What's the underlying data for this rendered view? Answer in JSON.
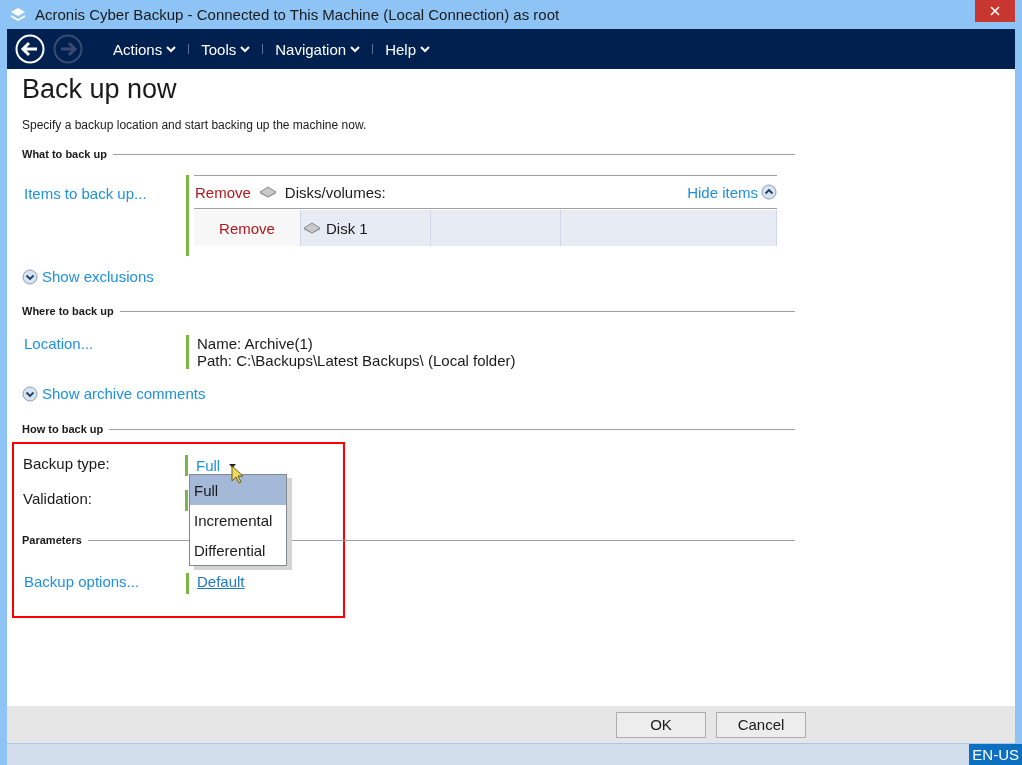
{
  "window": {
    "title": "Acronis Cyber Backup - Connected to This Machine (Local Connection) as root"
  },
  "nav": {
    "back_disabled": false,
    "forward_disabled": true
  },
  "menu": [
    {
      "label": "Actions"
    },
    {
      "label": "Tools"
    },
    {
      "label": "Navigation"
    },
    {
      "label": "Help"
    }
  ],
  "page": {
    "title": "Back up now",
    "description": "Specify a backup location and start backing up the machine now."
  },
  "what": {
    "heading": "What to back up",
    "link": "Items to back up...",
    "group": {
      "remove": "Remove",
      "label": "Disks/volumes:",
      "hide": "Hide items",
      "items": [
        {
          "remove": "Remove",
          "name": "Disk 1"
        }
      ]
    },
    "toggle": "Show exclusions"
  },
  "where": {
    "heading": "Where to back up",
    "link": "Location...",
    "lines": [
      "Name: Archive(1)",
      "Path: C:\\Backups\\Latest Backups\\ (Local folder)"
    ],
    "toggle": "Show archive comments"
  },
  "how": {
    "heading": "How to back up",
    "rows": [
      {
        "label": "Backup type:",
        "value": "Full"
      },
      {
        "label": "Validation:"
      }
    ]
  },
  "parameters": {
    "heading": "Parameters",
    "link": "Backup options...",
    "value": "Default"
  },
  "dropdown": {
    "options": [
      {
        "label": "Full",
        "selected": true
      },
      {
        "label": "Incremental",
        "selected": false
      },
      {
        "label": "Differential",
        "selected": false
      }
    ]
  },
  "buttons": [
    {
      "label": "OK"
    },
    {
      "label": "Cancel"
    }
  ],
  "status_bar": {
    "language": "EN-US"
  }
}
